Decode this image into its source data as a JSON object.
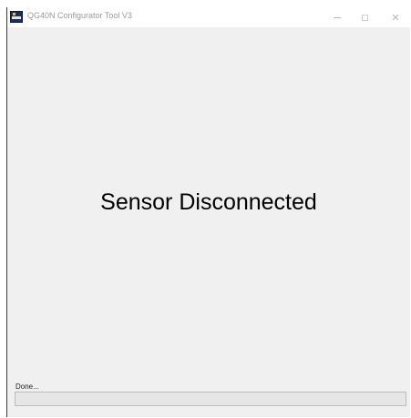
{
  "window": {
    "title": "QG40N Configurator Tool V3",
    "controls": {
      "close_glyph": "✕"
    }
  },
  "main": {
    "message": "Sensor Disconnected"
  },
  "status": {
    "label": "Done...",
    "progress_percent": 0
  },
  "colors": {
    "window_background": "#f0f0f0",
    "progress_fill": "#06b025"
  }
}
